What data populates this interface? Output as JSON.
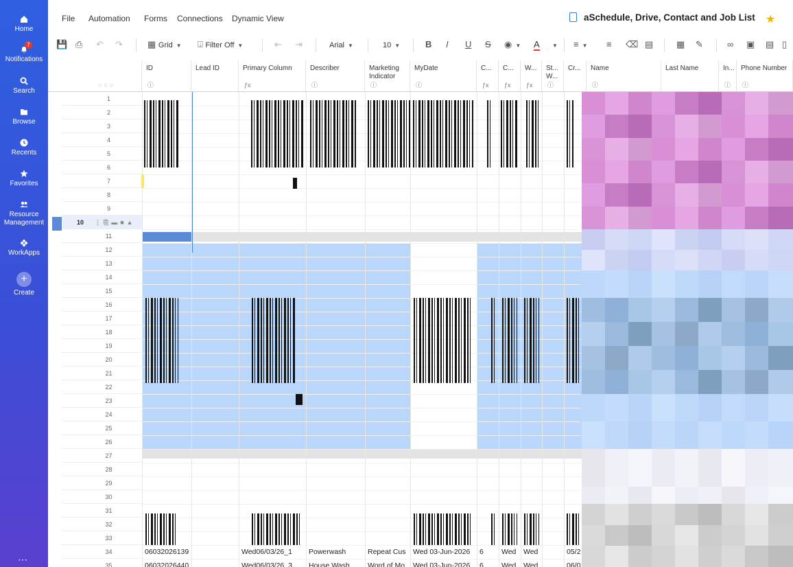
{
  "nav": {
    "items": [
      {
        "label": "Home"
      },
      {
        "label": "Notifications",
        "badge": "7"
      },
      {
        "label": "Search"
      },
      {
        "label": "Browse"
      },
      {
        "label": "Recents"
      },
      {
        "label": "Favorites"
      },
      {
        "label": "Resource Management"
      },
      {
        "label": "WorkApps"
      },
      {
        "label": "Create"
      }
    ]
  },
  "menu": {
    "items": [
      "File",
      "Automation",
      "Forms",
      "Connections",
      "Dynamic View"
    ],
    "sheet_title": "aSchedule, Drive, Contact and Job List"
  },
  "toolbar": {
    "view": "Grid",
    "filter": "Filter Off",
    "font": "Arial",
    "font_size": "10",
    "bold": "B",
    "italic": "I",
    "underline": "U",
    "strike": "S",
    "text_color": "A"
  },
  "columns": [
    {
      "label": "ID",
      "sub": "ⓘ"
    },
    {
      "label": "Lead ID",
      "sub": ""
    },
    {
      "label": "Primary Column",
      "sub": "ƒx"
    },
    {
      "label": "Describer",
      "sub": "ⓘ"
    },
    {
      "label": "Marketing Indicator",
      "sub": "ⓘ"
    },
    {
      "label": "MyDate",
      "sub": "ⓘ"
    },
    {
      "label": "C...",
      "sub": "ƒx"
    },
    {
      "label": "C...",
      "sub": "ƒx"
    },
    {
      "label": "W...",
      "sub": "ƒx"
    },
    {
      "label": "St... W...",
      "sub": "ⓘ"
    },
    {
      "label": "Cr...",
      "sub": ""
    },
    {
      "label": "Name",
      "sub": "ⓘ"
    },
    {
      "label": "Last Name",
      "sub": ""
    },
    {
      "label": "In...",
      "sub": "ⓘ"
    },
    {
      "label": "Phone Number",
      "sub": "ⓘ"
    }
  ],
  "rows": [
    "1",
    "2",
    "3",
    "4",
    "5",
    "6",
    "7",
    "8",
    "9",
    "10",
    "11",
    "12",
    "13",
    "14",
    "15",
    "16",
    "17",
    "18",
    "19",
    "20",
    "21",
    "22",
    "23",
    "24",
    "25",
    "26",
    "27",
    "28",
    "29",
    "30",
    "31",
    "32",
    "33",
    "34",
    "35"
  ],
  "active_row": "10",
  "row34": [
    "06032026139",
    "",
    "Wed06/03/26_1",
    "Powerwash",
    "Repeat Cus",
    "Wed 03-Jun-2026",
    "6",
    "Wed",
    "Wed",
    "",
    "05/2"
  ],
  "row35": [
    "06032026440",
    "",
    "Wed06/03/26_3",
    "House Wash",
    "Word of Mo",
    "Wed 03-Jun-2026",
    "6",
    "Wed",
    "Wed",
    "",
    "06/0"
  ]
}
